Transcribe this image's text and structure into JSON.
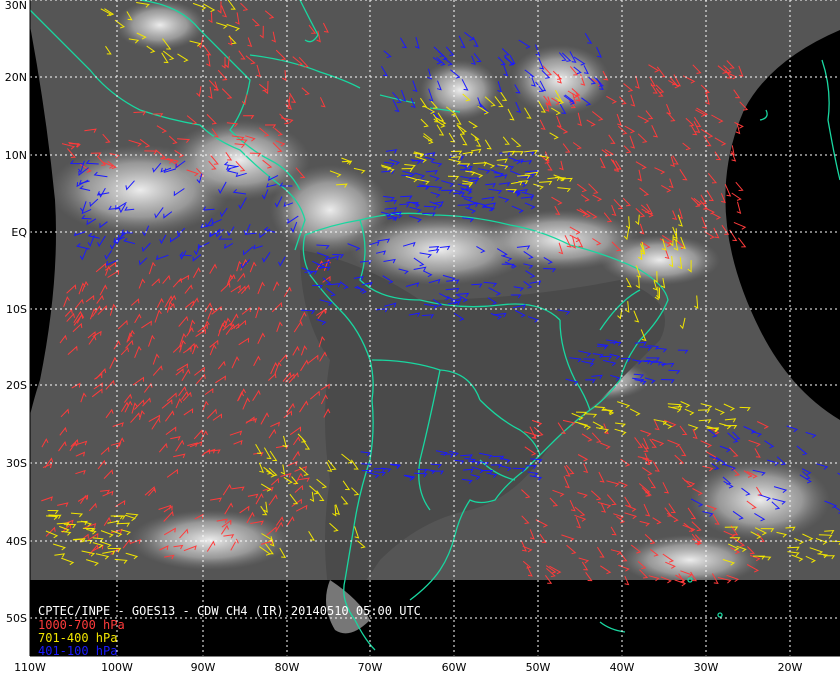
{
  "title": "CPTEC/INPE - GOES13 - CDW CH4 (IR) 20140510 05:00 UTC",
  "legend": [
    {
      "label": "1000-700 hPa",
      "color": "#ff3b3b"
    },
    {
      "label": "701-400 hPa",
      "color": "#f2e600"
    },
    {
      "label": "401-100 hPa",
      "color": "#1a1aff"
    }
  ],
  "lat_labels": [
    "30N",
    "20N",
    "10N",
    "EQ",
    "10S",
    "20S",
    "30S",
    "40S",
    "50S"
  ],
  "lon_labels": [
    "110W",
    "100W",
    "90W",
    "80W",
    "70W",
    "60W",
    "50W",
    "40W",
    "30W",
    "20W"
  ],
  "colors": {
    "coastline": "#19d7a0",
    "space": "#000000",
    "graticule": "#ffffff",
    "frame": "#ffffff",
    "cloud": "#e8e8e8",
    "ocean": "#595959"
  }
}
